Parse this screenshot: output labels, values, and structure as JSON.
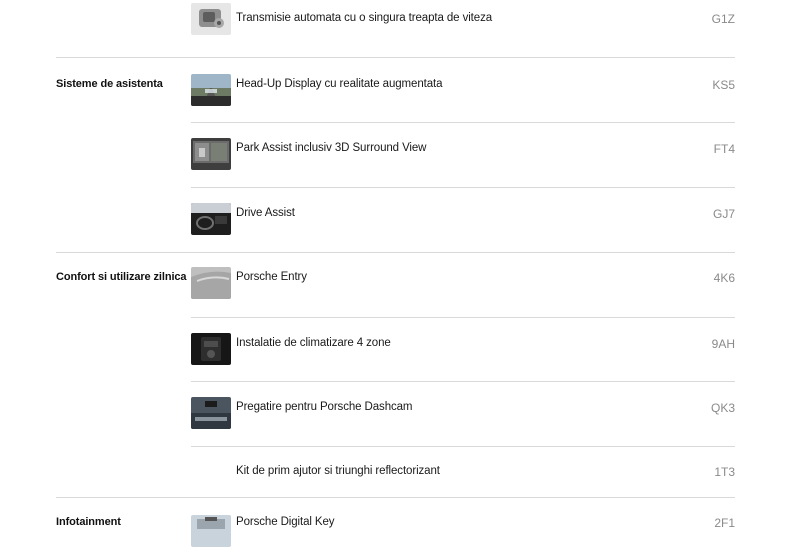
{
  "items": [
    {
      "category": "",
      "label": "Transmisie automata cu o singura treapta de viteza",
      "code": "G1Z",
      "icon": "transmission-icon"
    },
    {
      "category": "Sisteme de asistenta",
      "label": "Head-Up Display cu realitate augmentata",
      "code": "KS5",
      "icon": "head-up-display-icon"
    },
    {
      "category": "",
      "label": "Park Assist inclusiv 3D Surround View",
      "code": "FT4",
      "icon": "park-assist-icon"
    },
    {
      "category": "",
      "label": "Drive Assist",
      "code": "GJ7",
      "icon": "drive-assist-icon"
    },
    {
      "category": "Confort si utilizare zilnica",
      "label": "Porsche Entry",
      "code": "4K6",
      "icon": "porsche-entry-icon"
    },
    {
      "category": "",
      "label": "Instalatie de climatizare 4 zone",
      "code": "9AH",
      "icon": "climate-control-icon"
    },
    {
      "category": "",
      "label": "Pregatire pentru Porsche Dashcam",
      "code": "QK3",
      "icon": "dashcam-icon"
    },
    {
      "category": "",
      "label": "Kit de prim ajutor si triunghi reflectorizant",
      "code": "1T3",
      "icon": ""
    },
    {
      "category": "Infotainment",
      "label": "Porsche Digital Key",
      "code": "2F1",
      "icon": "digital-key-icon"
    }
  ]
}
